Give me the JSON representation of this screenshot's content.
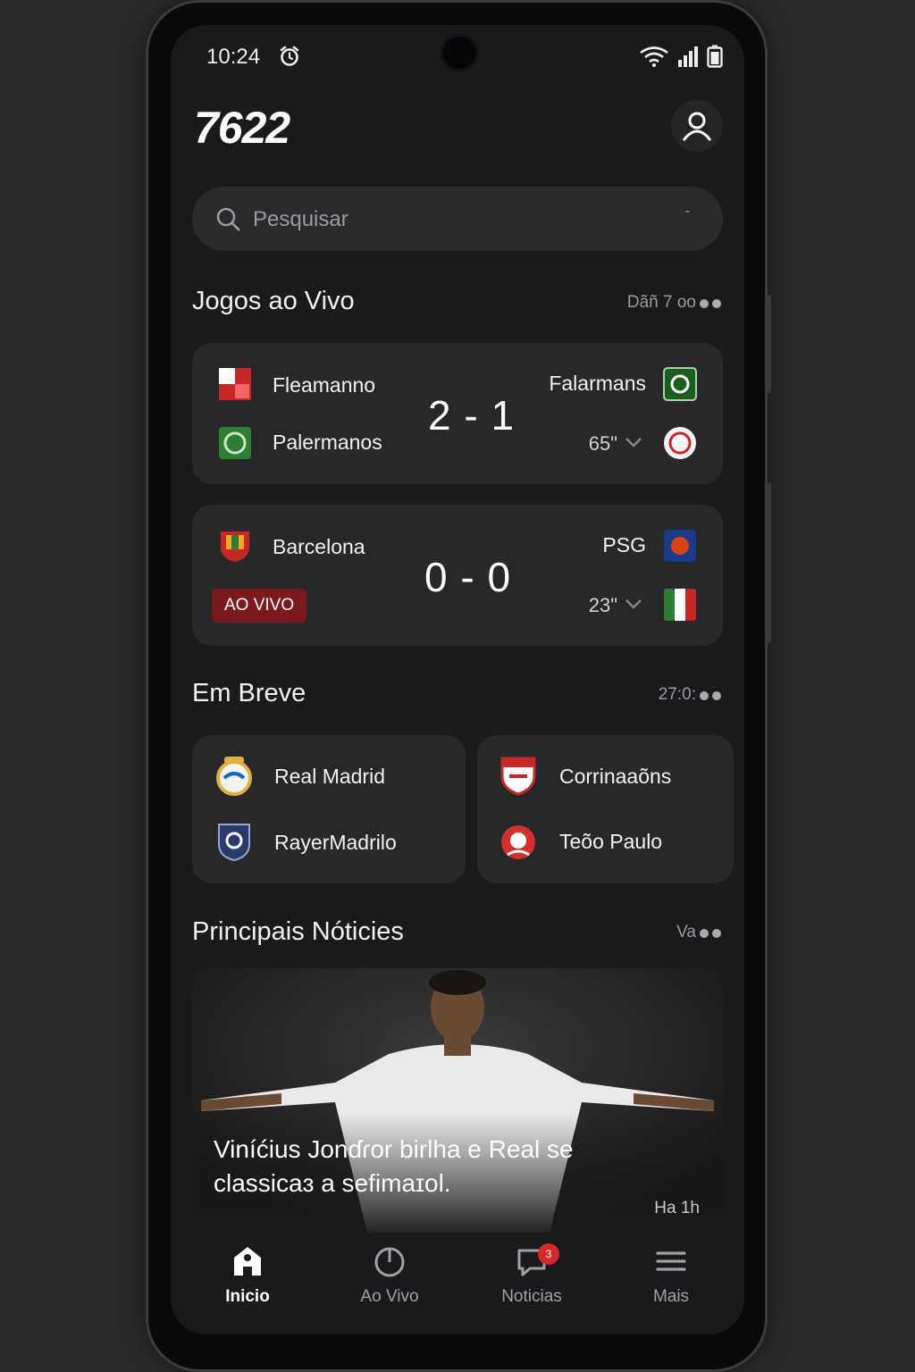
{
  "status_bar": {
    "time": "10:24"
  },
  "app": {
    "logo": "7622"
  },
  "search": {
    "placeholder": "Pesquisar"
  },
  "live_section": {
    "title": "Jogos ao Vivo",
    "meta": "Dãñ 7 ᴏᴏ"
  },
  "live_matches": [
    {
      "home_top": "Fleamanno",
      "home_bottom": "Palermanos",
      "score": "2 - 1",
      "away_top": "Falarmans",
      "minute": "65\""
    },
    {
      "home_top": "Barcelona",
      "live_badge": "AO VIVO",
      "score": "0 - 0",
      "away_top": "PSG",
      "minute": "23\""
    }
  ],
  "upcoming_section": {
    "title": "Em Breve",
    "meta": "27:0:"
  },
  "upcoming": [
    {
      "team_a": "Real Madrid",
      "team_b": "RayerMadrilo"
    },
    {
      "team_a": "Corrinaaõns",
      "team_b": "Teõo Paulo"
    }
  ],
  "news_section": {
    "title": "Principais Nóticies",
    "meta": "Va"
  },
  "news": {
    "title": "Viníćius Jonɗɾor birlha e Real se classicaɜ a sefimaɪol.",
    "time": "Ha 1h"
  },
  "nav": {
    "items": [
      "Inicio",
      "Ao Vivo",
      "Noticias",
      "Mais"
    ],
    "badge": "3"
  },
  "colors": {
    "background": "#1a1a1c",
    "card": "#28282b",
    "live_badge": "#7a1a1e",
    "notification": "#d42a2a"
  }
}
